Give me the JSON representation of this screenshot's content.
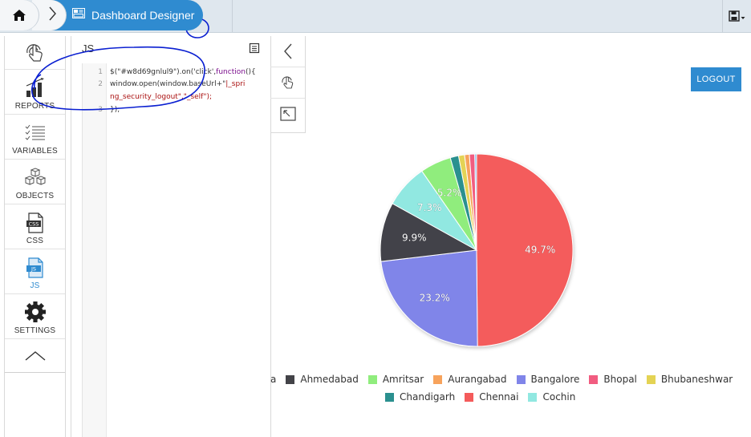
{
  "header": {
    "title": "Dashboard Designer"
  },
  "sidebar": {
    "items": [
      {
        "label": "REPORTS"
      },
      {
        "label": "VARIABLES"
      },
      {
        "label": "OBJECTS"
      },
      {
        "label": "CSS"
      },
      {
        "label": "JS"
      },
      {
        "label": "SETTINGS"
      }
    ]
  },
  "js_panel": {
    "title": "JS",
    "line_numbers": [
      "1",
      "2",
      "3"
    ],
    "code": {
      "line1_a": "$(\"#w8d69gnlul9\").on('click',",
      "line1_kw": "function",
      "line1_b": "(){",
      "line2_a": "window.open(window.baseUrl+\"",
      "line2_str": "|_spri",
      "line2_c": "ng_security_logout\",\"_self\");",
      "line3": "});"
    }
  },
  "logout_label": "LOGOUT",
  "colors": {
    "accent": "#2f8bd0",
    "annotation": "#0a1fd1"
  },
  "chart_data": {
    "type": "pie",
    "categories": [
      "Agra",
      "Ahmedabad",
      "Amritsar",
      "Aurangabad",
      "Bangalore",
      "Bhopal",
      "Bhubaneshwar",
      "Chandigarh",
      "Chennai",
      "Cochin"
    ],
    "legend_labels": [
      "a",
      "Ahmedabad",
      "Amritsar",
      "Aurangabad",
      "Bangalore",
      "Bhopal",
      "Bhubaneshwar",
      "Chandigarh",
      "Chennai",
      "Cochin"
    ],
    "values": [
      0.3,
      9.9,
      5.2,
      0.8,
      23.2,
      0.9,
      1.0,
      1.4,
      49.7,
      7.3
    ],
    "data_labels": [
      "49.7%",
      "23.2%",
      "9.9%",
      "7.3%",
      "5.2%"
    ],
    "colors": {
      "Agra": "#7cb5ec",
      "Ahmedabad": "#434348",
      "Amritsar": "#90ed7d",
      "Aurangabad": "#f7a35c",
      "Bangalore": "#8085e9",
      "Bhopal": "#f15c80",
      "Bhubaneshwar": "#e4d354",
      "Chandigarh": "#2b908f",
      "Chennai": "#f45b5b",
      "Cochin": "#91e8e1"
    },
    "slice_order": [
      "Chennai",
      "Bangalore",
      "Ahmedabad",
      "Cochin",
      "Amritsar",
      "Chandigarh",
      "Bhubaneshwar",
      "Aurangabad",
      "Bhopal",
      "Agra"
    ],
    "legend_position": "bottom"
  }
}
